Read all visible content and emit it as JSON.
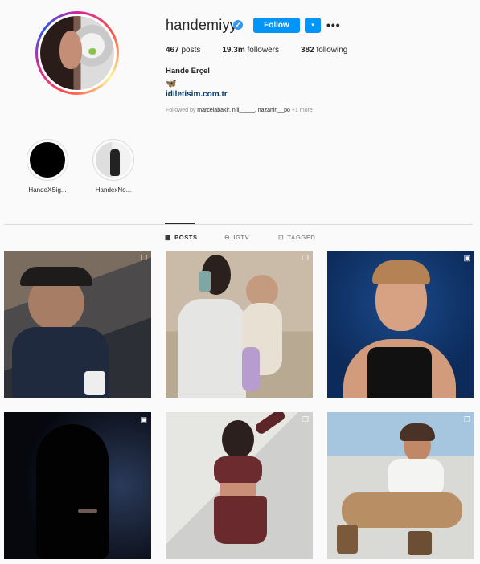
{
  "profile": {
    "username": "handemiyy",
    "follow_label": "Follow",
    "dropdown_glyph": "▾",
    "more_glyph": "•••",
    "stats": [
      {
        "value": "467",
        "label": "posts"
      },
      {
        "value": "19.3m",
        "label": "followers"
      },
      {
        "value": "382",
        "label": "following"
      }
    ],
    "full_name": "Hande Erçel",
    "bio_emoji": "🦋",
    "website": "idiletisim.com.tr",
    "followed_by_prefix": "Followed by ",
    "followed_by_names": "marcelabakir, nili_____, nazanin__po",
    "followed_by_more": " +1 more",
    "verified_glyph": "✓"
  },
  "highlights": [
    {
      "label": "HandeXSig..."
    },
    {
      "label": "HandexNo..."
    }
  ],
  "tabs": [
    {
      "label": "POSTS",
      "icon": "grid-icon",
      "glyph": "▦",
      "active": true
    },
    {
      "label": "IGTV",
      "icon": "igtv-icon",
      "glyph": "⊖",
      "active": false
    },
    {
      "label": "TAGGED",
      "icon": "tagged-icon",
      "glyph": "⊡",
      "active": false
    }
  ],
  "posts": [
    {
      "type_icon": "multi-photo-icon",
      "glyph": "❐"
    },
    {
      "type_icon": "multi-photo-icon",
      "glyph": "❐"
    },
    {
      "type_icon": "video-icon",
      "glyph": "▣"
    },
    {
      "type_icon": "video-icon",
      "glyph": "▣"
    },
    {
      "type_icon": "multi-photo-icon",
      "glyph": "❐"
    },
    {
      "type_icon": "multi-photo-icon",
      "glyph": "❐"
    }
  ],
  "colors": {
    "accent": "#0095f6",
    "link": "#00376b",
    "muted": "#8e8e8e",
    "background": "#fafafa"
  }
}
